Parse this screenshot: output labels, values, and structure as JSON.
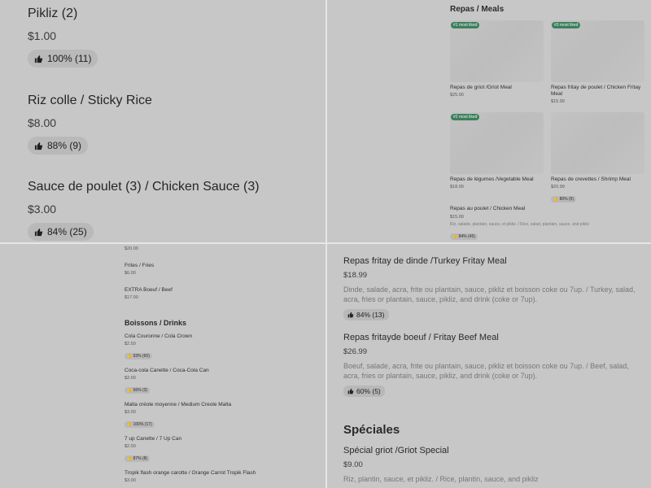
{
  "q1": {
    "items": [
      {
        "name": "Pikliz (2)",
        "price": "$1.00",
        "rating": "100% (11)"
      },
      {
        "name": "Riz colle / Sticky Rice",
        "price": "$8.00",
        "rating": "88% (9)"
      },
      {
        "name": "Sauce de poulet (3) / Chicken Sauce (3)",
        "price": "$3.00",
        "rating": "84% (25)"
      }
    ]
  },
  "q2": {
    "section_title": "Repas / Meals",
    "cards": [
      {
        "badge": "#1 most liked",
        "name": "Repas de griot /Griot Meal",
        "price": "$25.00"
      },
      {
        "badge": "#3 most liked",
        "name": "Repas fritay de poulet / Chicken Fritay Meal",
        "price": "$15.99"
      },
      {
        "badge": "#2 most liked",
        "name": "Repas de légumes /Vegetable Meal",
        "price": "$18.99"
      },
      {
        "badge": "",
        "name": "Repas de crevettes / Shrimp Meal",
        "price": "$20.99",
        "rating": "80% (5)"
      }
    ],
    "wide": {
      "name": "Repas au poulet / Chicken Meal",
      "price": "$15.00",
      "desc": "Riz, salade, plantain, sauce, et pikliz. / Rice, salad, plantain, sauce, and pikliz",
      "rating": "84% (45)"
    }
  },
  "q3": {
    "top_price": "$20.00",
    "items_before": [
      {
        "name": "Frites / Fries",
        "price": "$6.00"
      },
      {
        "name": "EXTRA Boeuf / Beef",
        "price": "$17.00"
      }
    ],
    "section_title": "Boissons / Drinks",
    "drinks": [
      {
        "name": "Cola Couronne / Cola Crown",
        "price": "$2.50",
        "rating": "93% (60)"
      },
      {
        "name": "Coca-cola Canette / Coca-Cola Can",
        "price": "$2.00",
        "rating": "66% (3)"
      },
      {
        "name": "Malta créole moyenne / Medium Creole Malta",
        "price": "$3.00",
        "rating": "100% (17)"
      },
      {
        "name": "7 up Canette / 7 Up Can",
        "price": "$2.00",
        "rating": "87% (8)"
      },
      {
        "name": "Tropik flash orange carotte / Orange Carrot Tropik Flash",
        "price": "$3.00"
      }
    ]
  },
  "q4": {
    "items": [
      {
        "name": "Repas fritay de dinde /Turkey Fritay Meal",
        "price": "$18.99",
        "desc": "Dinde, salade, acra, frite ou plantain, sauce, pikliz et boisson coke ou 7up. / Turkey, salad, acra, fries or plantain, sauce, pikliz, and drink (coke or 7up).",
        "rating": "84% (13)"
      },
      {
        "name": "Repas fritayde boeuf / Fritay Beef Meal",
        "price": "$26.99",
        "desc": "Boeuf, salade, acra, frite ou plantain, sauce, pikliz et boisson coke ou 7up. / Beef, salad, acra, fries or plantain, sauce, pikliz, and drink (coke or 7up).",
        "rating": "60% (5)"
      }
    ],
    "section_title": "Spéciales",
    "special": {
      "name": "Spécial griot /Griot Special",
      "price": "$9.00",
      "desc": "Riz, plantin, sauce, et pikliz. / Rice, plantin, sauce, and pikliz"
    }
  }
}
